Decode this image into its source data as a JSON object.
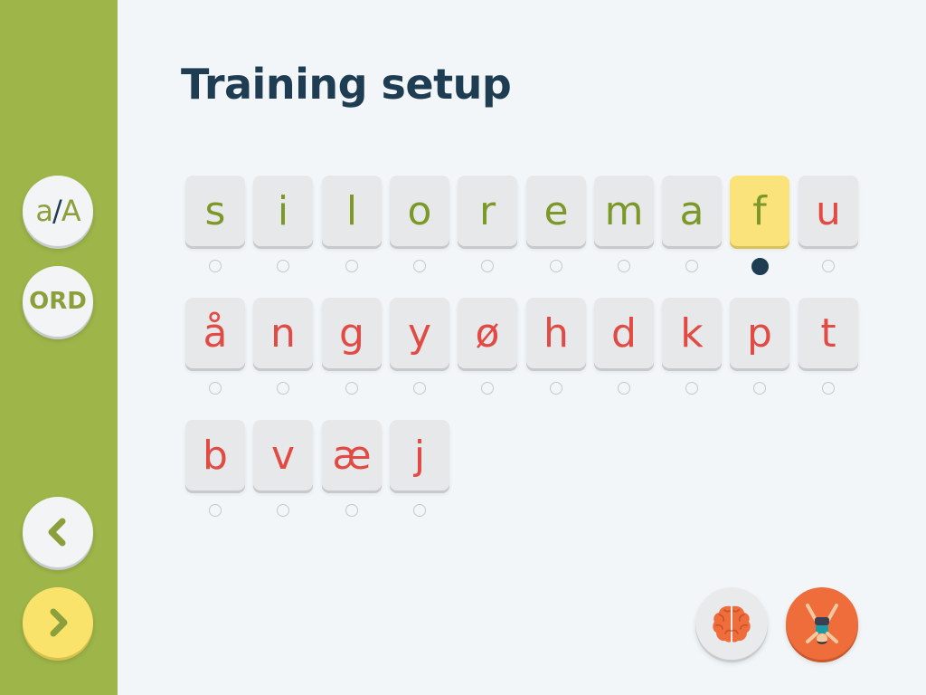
{
  "title": "Training setup",
  "sidebar": {
    "case_toggle": {
      "lower": "a",
      "slash": "/",
      "upper": "A"
    },
    "word_button": "ORD",
    "back_icon": "chevron-left-icon",
    "next_icon": "chevron-right-icon"
  },
  "letters": [
    {
      "char": "s",
      "color": "green"
    },
    {
      "char": "i",
      "color": "green"
    },
    {
      "char": "l",
      "color": "green"
    },
    {
      "char": "o",
      "color": "green"
    },
    {
      "char": "r",
      "color": "green"
    },
    {
      "char": "e",
      "color": "green"
    },
    {
      "char": "m",
      "color": "green"
    },
    {
      "char": "a",
      "color": "green"
    },
    {
      "char": "f",
      "color": "green",
      "selected": true
    },
    {
      "char": "u",
      "color": "red"
    },
    {
      "char": "å",
      "color": "red"
    },
    {
      "char": "n",
      "color": "red"
    },
    {
      "char": "g",
      "color": "red"
    },
    {
      "char": "y",
      "color": "red"
    },
    {
      "char": "ø",
      "color": "red"
    },
    {
      "char": "h",
      "color": "red"
    },
    {
      "char": "d",
      "color": "red"
    },
    {
      "char": "k",
      "color": "red"
    },
    {
      "char": "p",
      "color": "red"
    },
    {
      "char": "t",
      "color": "red"
    },
    {
      "char": "b",
      "color": "red"
    },
    {
      "char": "v",
      "color": "red"
    },
    {
      "char": "æ",
      "color": "red"
    },
    {
      "char": "j",
      "color": "red"
    }
  ],
  "bottom_buttons": {
    "brain_icon": "brain-icon",
    "exercise_icon": "handstand-figure-icon"
  },
  "colors": {
    "sidebar": "#9db549",
    "title": "#1e3d52",
    "learned_letter": "#7c9828",
    "new_letter": "#e24a44",
    "selected_tile": "#fbe37c",
    "next_button": "#fae36a",
    "exercise_button": "#ee6d3a"
  }
}
